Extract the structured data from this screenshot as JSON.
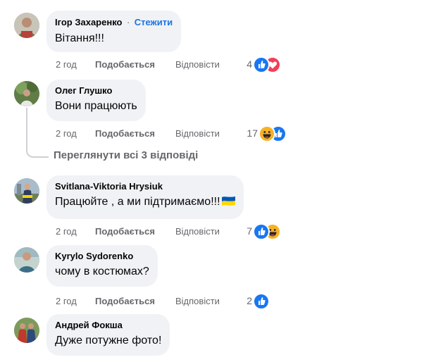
{
  "comments": [
    {
      "author": "Ігор Захаренко",
      "follow_label": "Стежити",
      "text": "Вітання!!!",
      "time": "2 год",
      "like_label": "Подобається",
      "reply_label": "Відповісти",
      "reaction_count": "4",
      "reactions": [
        "like-icon",
        "love-icon"
      ]
    },
    {
      "author": "Олег Глушко",
      "text": "Вони працюють",
      "time": "2 год",
      "like_label": "Подобається",
      "reply_label": "Відповісти",
      "reaction_count": "17",
      "reactions": [
        "haha-icon",
        "like-icon"
      ]
    },
    {
      "author": "Svitlana-Viktoria Hrysiuk",
      "text": "Працюйте , а ми підтримаємо!!!",
      "time": "2 год",
      "like_label": "Подобається",
      "reply_label": "Відповісти",
      "reaction_count": "7",
      "reactions": [
        "like-icon",
        "haha-icon"
      ]
    },
    {
      "author": "Kyrylo Sydorenko",
      "text": "чому в костюмах?",
      "time": "2 год",
      "like_label": "Подобається",
      "reply_label": "Відповісти",
      "reaction_count": "2",
      "reactions": [
        "like-icon"
      ]
    },
    {
      "author": "Андрей Фокша",
      "text": "Дуже потужне фото!"
    }
  ],
  "view_replies_label": "Переглянути всі 3 відповіді",
  "colors": {
    "bubble": "#f0f2f5",
    "secondary_text": "#65676b",
    "link": "#1b74e4",
    "like_blue": "#1877f2",
    "love_red": "#f33e58",
    "haha_yellow": "#f7b125",
    "flag_blue": "#0057b7",
    "flag_yellow": "#ffd700"
  }
}
